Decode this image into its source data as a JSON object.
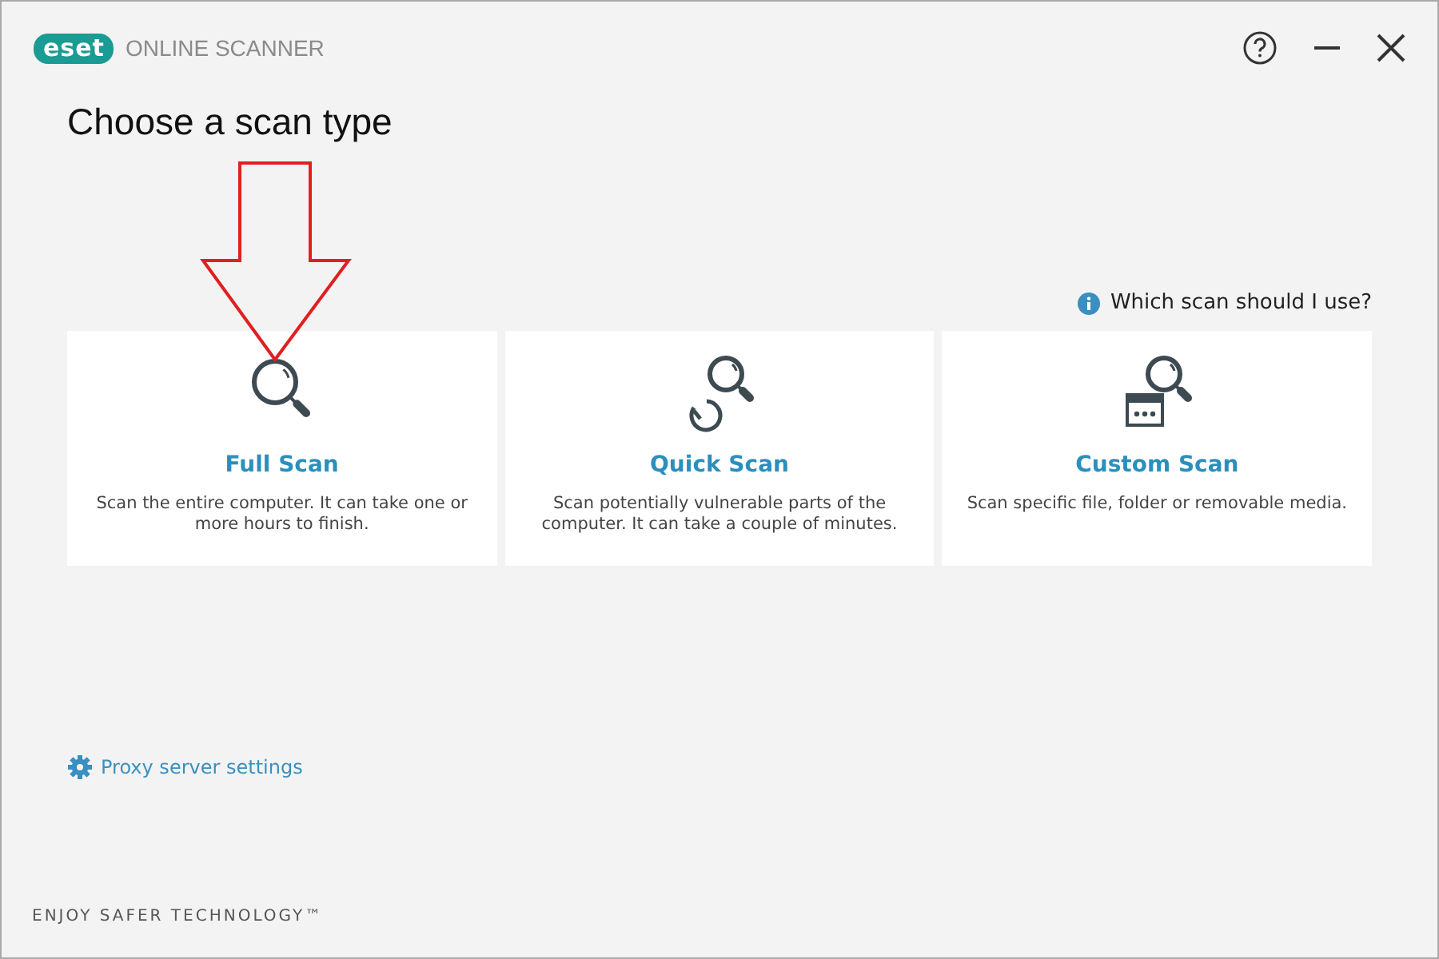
{
  "window": {
    "logo": "eset",
    "product": "ONLINE SCANNER"
  },
  "title": "Choose a scan type",
  "help_link": "Which scan should I use?",
  "scan_types": [
    {
      "kind": "full",
      "name": "Full Scan",
      "description": "Scan the entire computer. It can take one or more hours to finish."
    },
    {
      "kind": "quick",
      "name": "Quick Scan",
      "description": "Scan potentially vulnerable parts of the computer. It can take a couple of minutes."
    },
    {
      "kind": "custom",
      "name": "Custom Scan",
      "description": "Scan specific file, folder or removable media."
    }
  ],
  "proxy_link": "Proxy server settings",
  "footer": "ENJOY SAFER TECHNOLOGY™"
}
